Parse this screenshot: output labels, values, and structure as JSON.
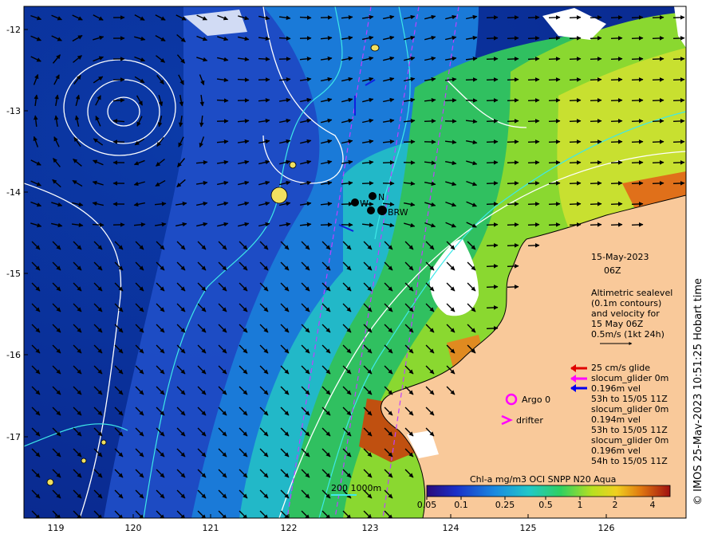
{
  "map": {
    "lon_ticks": [
      "119",
      "120",
      "121",
      "122",
      "123",
      "124",
      "125",
      "126"
    ],
    "lat_ticks": [
      "-12",
      "-13",
      "-14",
      "-15",
      "-16",
      "-17"
    ],
    "date": "15-May-2023",
    "time": "06Z",
    "description_lines": [
      "Altimetric sealevel",
      "(0.1m contours)",
      "and velocity for",
      "15 May 06Z",
      "0.5m/s (1kt 24h)"
    ],
    "station_labels": [
      "W",
      "N",
      "BRW"
    ],
    "glider_legend": {
      "speed_label": "25 cm/s glide",
      "entries": [
        "slocum_glider 0m",
        "0.196m vel",
        "53h to 15/05 11Z",
        "slocum_glider 0m",
        "0.194m vel",
        "53h to 15/05 11Z",
        "slocum_glider 0m",
        "0.196m vel",
        "54h to 15/05 11Z"
      ],
      "colors": {
        "glider1": "#e00000",
        "glider2": "#ff00ff",
        "glider3": "#0000ee"
      }
    },
    "argo_label": "Argo 0",
    "drifter_label": "drifter",
    "depth_contours_label": "200  1000m",
    "colorbar": {
      "title": "Chl-a mg/m3 OCI SNPP N20 Aqua",
      "ticks": [
        "0.05",
        "0.1",
        "0.25",
        "0.5",
        "1",
        "2",
        "4"
      ]
    },
    "credit": "© IMOS 25-May-2023 10:51:25 Hobart time",
    "colors": {
      "land": "#f9c99a",
      "ocean_deep": "#0a2f9c",
      "accent_magenta": "#ff00ff"
    }
  }
}
